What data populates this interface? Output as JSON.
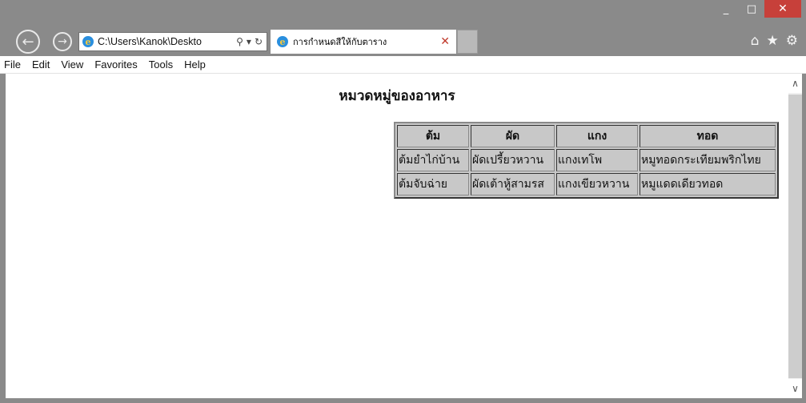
{
  "window": {
    "minimize_glyph": "_",
    "maximize_glyph": "□",
    "close_glyph": "✕"
  },
  "nav": {
    "back_glyph": "←",
    "forward_glyph": "→",
    "address": "C:\\Users\\Kanok\\Deskto",
    "search_glyph": "⚲",
    "dropdown_glyph": "▾",
    "refresh_glyph": "↻",
    "ie_glyph": "e"
  },
  "tab": {
    "title": "การกำหนดสีให้กับตาราง",
    "close_glyph": "✕"
  },
  "toolbar_icons": {
    "home": "⌂",
    "favorites": "★",
    "settings": "⚙"
  },
  "menu": [
    "File",
    "Edit",
    "View",
    "Favorites",
    "Tools",
    "Help"
  ],
  "page": {
    "heading": "หมวดหมู่ของอาหาร",
    "table": {
      "headers": [
        "ต้ม",
        "ผัด",
        "แกง",
        "ทอด"
      ],
      "rows": [
        [
          "ต้มยำไก่บ้าน",
          "ผัดเปรี้ยวหวาน",
          "แกงเทโพ",
          "หมูทอดกระเทียมพริกไทย"
        ],
        [
          "ต้มจับฉ่าย",
          "ผัดเต้าหู้สามรส",
          "แกงเขียวหวาน",
          "หมูแดดเดียวทอด"
        ]
      ]
    }
  },
  "scrollbar": {
    "up_glyph": "∧",
    "down_glyph": "∨"
  }
}
